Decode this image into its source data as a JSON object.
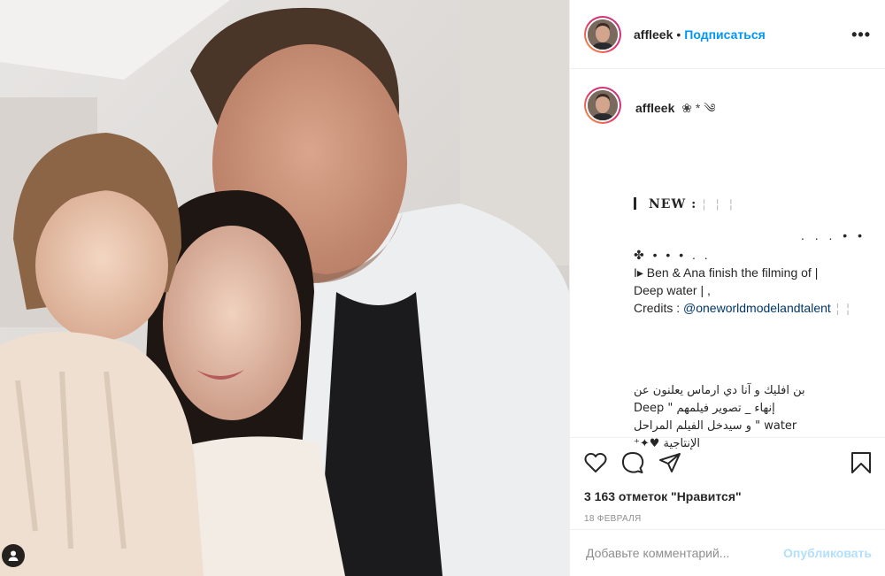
{
  "header": {
    "username": "affleek",
    "separator": "•",
    "follow_label": "Подписаться",
    "more_label": "•••"
  },
  "caption": {
    "username": "affleek",
    "username_decoration": "❀ * ༄",
    "new_label": "NEW :",
    "new_trail": "¦ ¦ ¦",
    "dots_right": ". . . • •",
    "line1": "✤ • • • . .",
    "line2": "I▸ Ben & Ana finish the filming of |",
    "line3": "Deep water | ,",
    "credits_prefix": "Credits : ",
    "credits_mention": "@oneworldmodelandtalent",
    "credits_trail": " ¦ ¦",
    "arabic_text": "بن افليك و آنا دي ارماس يعلنون عن إنهاء _ تصوير فيلمهم \" Deep water \" و سيدخل الفيلم المراحل الإنتاجية ♥✦⁺"
  },
  "engagement": {
    "likes": "3 163 отметок \"Нравится\"",
    "date": "18 ФЕВРАЛЯ"
  },
  "comment": {
    "placeholder": "Добавьте комментарий...",
    "publish_label": "Опубликовать"
  },
  "icons": {
    "like": "heart-icon",
    "comment": "comment-icon",
    "share": "share-icon",
    "save": "bookmark-icon",
    "user_tags": "user-tag-icon"
  },
  "colors": {
    "follow": "#0095f6",
    "publish_disabled": "#b2dffc",
    "mention": "#00376b",
    "secondary_text": "#8e8e8e",
    "border": "#efefef"
  }
}
